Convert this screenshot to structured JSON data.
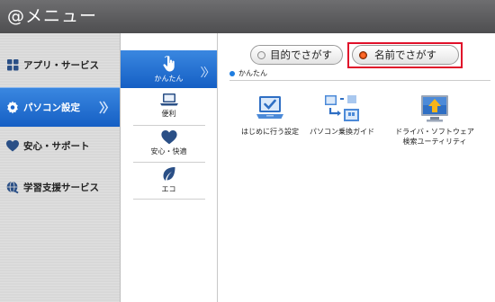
{
  "window": {
    "title": "@メニュー"
  },
  "leftnav": {
    "items": [
      {
        "label": "アプリ・サービス",
        "icon": "grid-icon"
      },
      {
        "label": "パソコン設定",
        "icon": "gear-icon",
        "active": true
      },
      {
        "label": "安心・サポート",
        "icon": "heart-icon"
      },
      {
        "label": "学習支援サービス",
        "icon": "globe-icon"
      }
    ]
  },
  "categories": [
    {
      "label": "かんたん",
      "icon": "hand-icon",
      "active": true
    },
    {
      "label": "便利",
      "icon": "laptop-icon"
    },
    {
      "label": "安心・快適",
      "icon": "heart-icon"
    },
    {
      "label": "エコ",
      "icon": "leaf-icon"
    }
  ],
  "search": {
    "by_purpose": "目的でさがす",
    "by_name": "名前でさがす",
    "selected": "名前でさがす"
  },
  "section": {
    "label": "かんたん"
  },
  "apps": [
    {
      "label": "はじめに行う設定",
      "icon": "laptop-check-icon"
    },
    {
      "label": "パソコン乗換ガイド",
      "icon": "transfer-icon"
    },
    {
      "label_line1": "ドライバ・ソフトウェア",
      "label_line2": "検索ユーティリティ",
      "icon": "monitor-arrow-icon"
    }
  ],
  "colors": {
    "accent": "#1a6fd6",
    "highlight": "#e0102a",
    "titlebar": "#5a5a5c"
  }
}
